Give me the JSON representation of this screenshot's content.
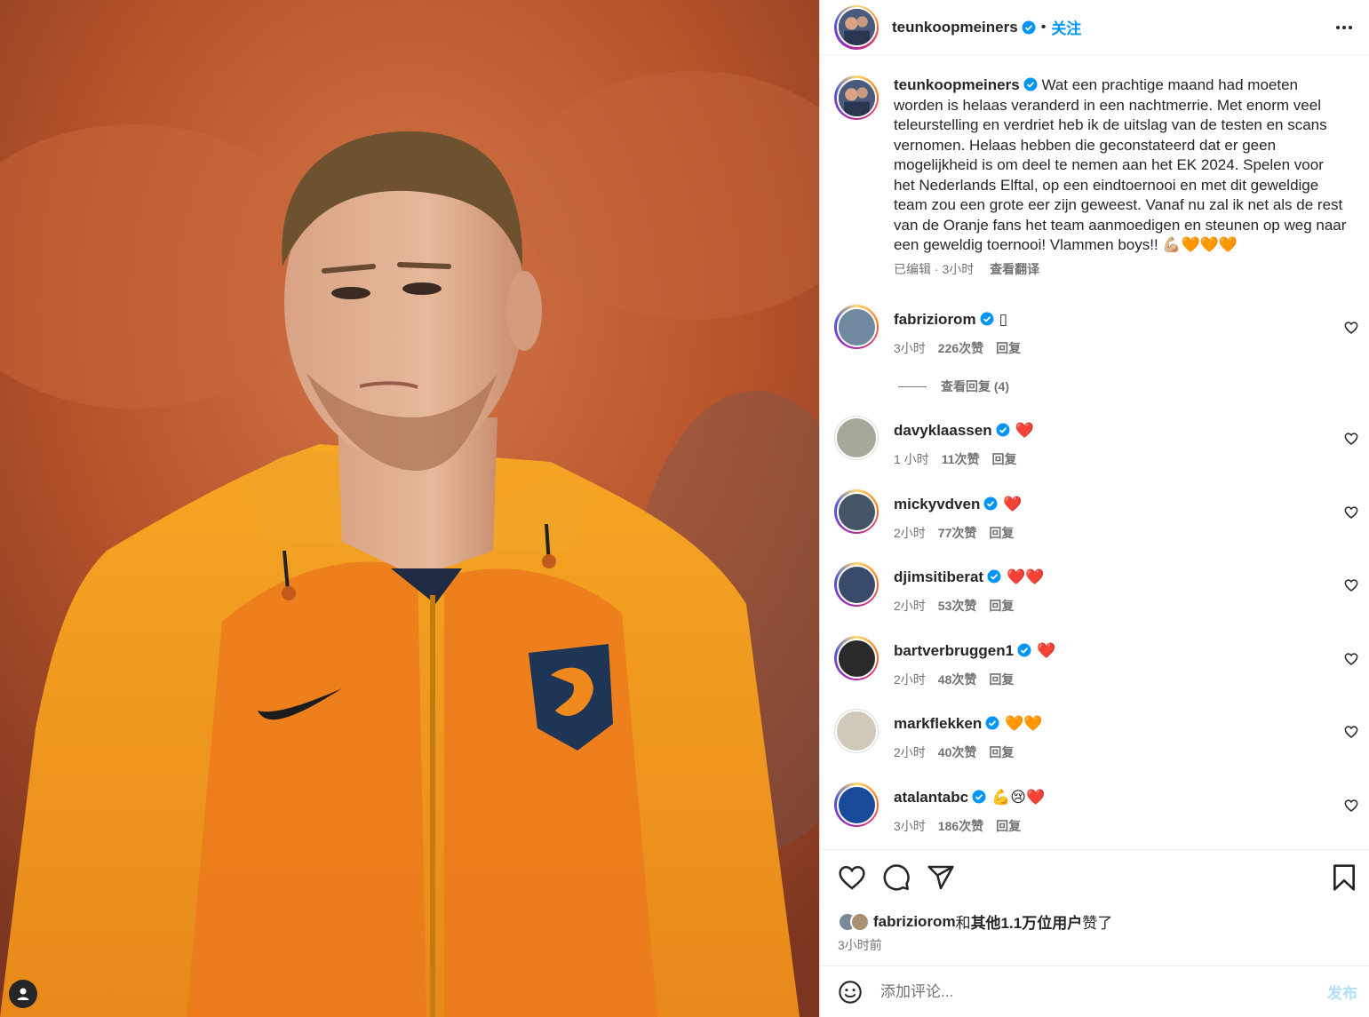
{
  "post": {
    "username": "teunkoopmeiners",
    "dot": "•",
    "follow_label": "关注",
    "caption": "Wat een prachtige maand had moeten worden is helaas veranderd in een nachtmerrie. Met enorm veel teleurstelling en verdriet heb ik de uitslag van de testen en scans vernomen. Helaas hebben die geconstateerd dat er geen mogelijkheid is om deel te nemen aan het EK 2024. Spelen voor het Nederlands Elftal, op een eindtoernooi en met dit geweldige team zou een grote eer zijn geweest. Vanaf nu zal ik net als de rest van de Oranje fans het team aanmoedigen en steunen op weg naar een geweldig toernooi! Vlammen boys!!",
    "caption_emojis": "💪🏼🧡🧡🧡",
    "edited_time": "已编辑 · 3小时",
    "translate_label": "查看翻译"
  },
  "comments": [
    {
      "username": "fabriziorom",
      "text": "▯",
      "time": "3小时",
      "likes": "226次赞",
      "reply": "回复",
      "ring": true
    },
    {
      "username": "davyklaassen",
      "text": "❤️",
      "time": "1 小时",
      "likes": "11次赞",
      "reply": "回复",
      "ring": false
    },
    {
      "username": "mickyvdven",
      "text": "❤️",
      "time": "2小时",
      "likes": "77次赞",
      "reply": "回复",
      "ring": true
    },
    {
      "username": "djimsitiberat",
      "text": "❤️❤️",
      "time": "2小时",
      "likes": "53次赞",
      "reply": "回复",
      "ring": true
    },
    {
      "username": "bartverbruggen1",
      "text": "❤️",
      "time": "2小时",
      "likes": "48次赞",
      "reply": "回复",
      "ring": true
    },
    {
      "username": "markflekken",
      "text": "🧡🧡",
      "time": "2小时",
      "likes": "40次赞",
      "reply": "回复",
      "ring": false
    },
    {
      "username": "atalantabc",
      "text": "💪😢❤️",
      "time": "3小时",
      "likes": "186次赞",
      "reply": "回复",
      "ring": true
    }
  ],
  "view_replies": "查看回复 (4)",
  "likes_summary": {
    "user": "fabriziorom",
    "joiner": "和",
    "others": "其他1.1万位用户",
    "suffix": "赞了"
  },
  "posted_time": "3小时前",
  "comment_box": {
    "placeholder": "添加评论...",
    "publish_label": "发布"
  },
  "colors": {
    "accent": "#0095f6",
    "publish_disabled": "#b2dffc",
    "muted": "#737373",
    "jacket_orange": "#f08a1c"
  }
}
